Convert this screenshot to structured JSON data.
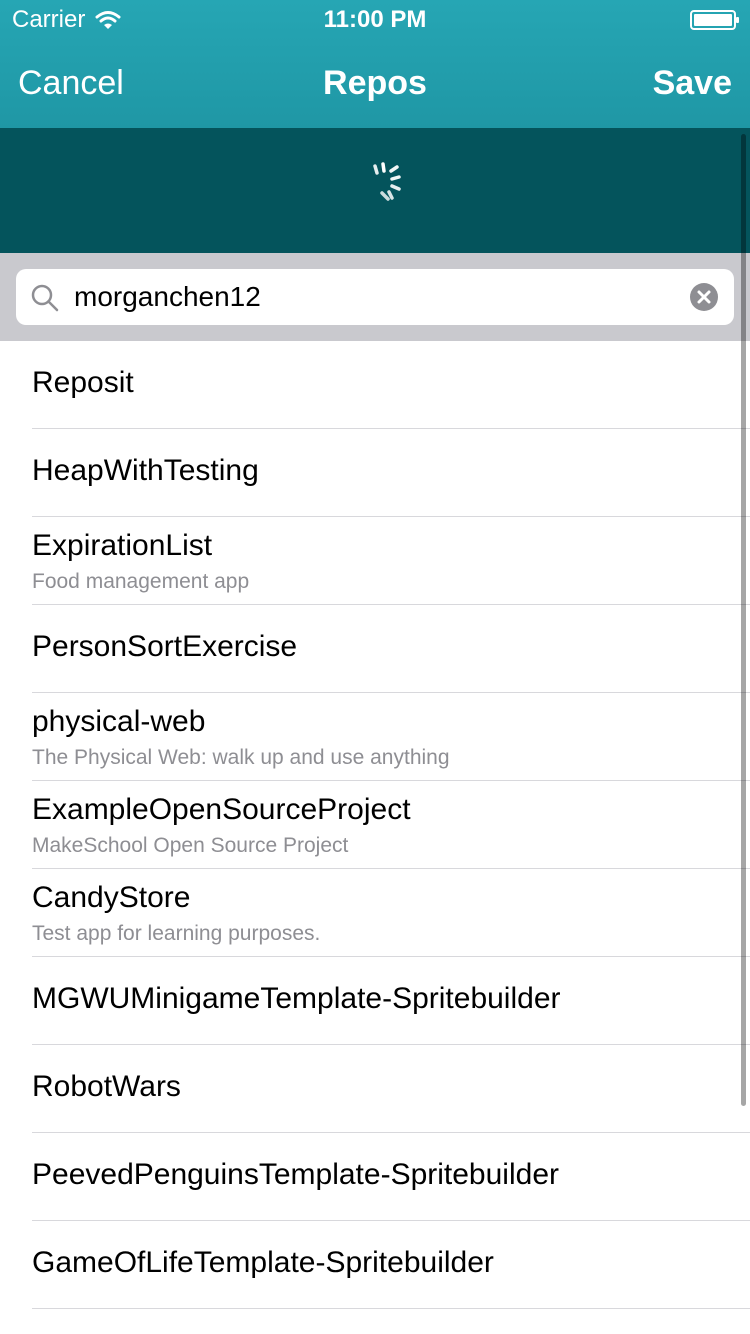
{
  "status": {
    "carrier": "Carrier",
    "time": "11:00 PM",
    "icons": [
      "wifi-icon",
      "battery-icon"
    ]
  },
  "nav": {
    "cancel_label": "Cancel",
    "title": "Repos",
    "save_label": "Save"
  },
  "loading": {
    "icon": "spinner-icon"
  },
  "search": {
    "value": "morganchen12",
    "icons": [
      "search-icon",
      "clear-icon"
    ]
  },
  "repos": [
    {
      "title": "Reposit",
      "subtitle": ""
    },
    {
      "title": "HeapWithTesting",
      "subtitle": ""
    },
    {
      "title": "ExpirationList",
      "subtitle": "Food management app"
    },
    {
      "title": "PersonSortExercise",
      "subtitle": ""
    },
    {
      "title": "physical-web",
      "subtitle": "The Physical Web: walk up and use anything"
    },
    {
      "title": "ExampleOpenSourceProject",
      "subtitle": "MakeSchool Open Source Project"
    },
    {
      "title": "CandyStore",
      "subtitle": "Test app for learning purposes."
    },
    {
      "title": "MGWUMinigameTemplate-Spritebuilder",
      "subtitle": ""
    },
    {
      "title": "RobotWars",
      "subtitle": ""
    },
    {
      "title": "PeevedPenguinsTemplate-Spritebuilder",
      "subtitle": ""
    },
    {
      "title": "GameOfLifeTemplate-Spritebuilder",
      "subtitle": ""
    }
  ],
  "colors": {
    "nav_bar": "#23a0ae",
    "loading_strip": "#04545c",
    "search_background": "#c9c9ce",
    "subtitle_text": "#8e8e93"
  }
}
